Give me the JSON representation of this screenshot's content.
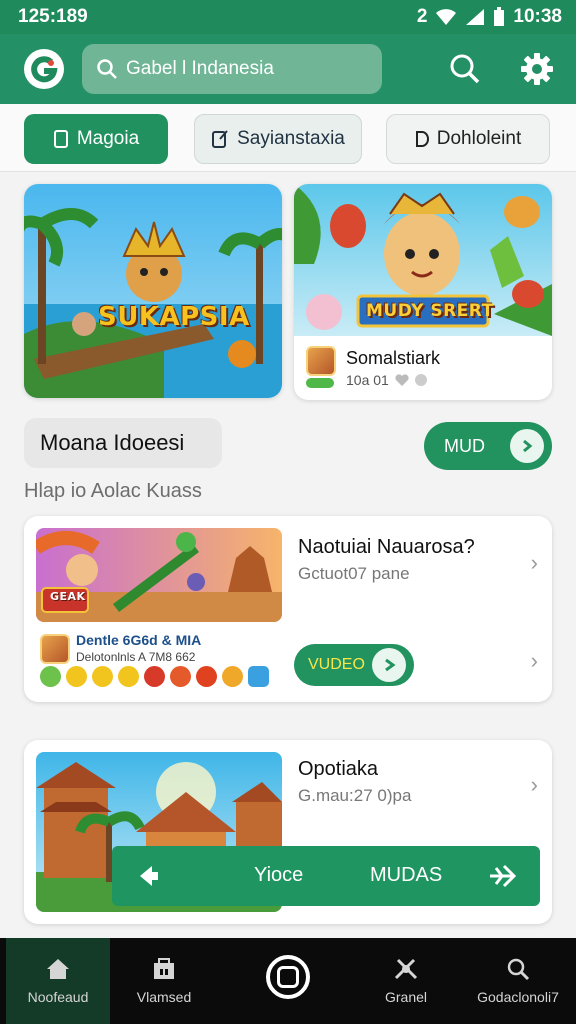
{
  "status_bar": {
    "time": "125:189",
    "right_time": "10:38",
    "signal_digit": "2"
  },
  "app_bar": {
    "search_text": "Gabel l Indanesia",
    "logo_letter": "G"
  },
  "tabs": [
    {
      "label": "Magoia",
      "active": true
    },
    {
      "label": "Sayianstaxia",
      "active": false
    },
    {
      "label": "Dohloleint",
      "active": false
    }
  ],
  "featured": [
    {
      "art_title": "SUKAPSIA"
    },
    {
      "art_title": "MUDY SRERT",
      "name": "Somalstiark",
      "meta": "10a 01"
    }
  ],
  "section": {
    "title": "Moana Idoeesi",
    "button_label": "MUD",
    "subtitle": "Hlap io Aolac Kuass"
  },
  "list": [
    {
      "title": "Naotuiai Nauarosa?",
      "meta": "Gctuot07 pane",
      "developer": "Dentle 6G6d & MIA",
      "dev_meta": "Delotonlnls A 7M8 662",
      "art_badge": "GEAK",
      "button_label": "VUDEO"
    },
    {
      "title": "Opotiaka",
      "meta": "G.mau:27 0)pa"
    }
  ],
  "action_bar": {
    "left_label": "Yioce",
    "right_label": "MUDAS"
  },
  "bottom_nav": [
    {
      "label": "Noofeaud",
      "icon": "home-icon"
    },
    {
      "label": "Vlamsed",
      "icon": "store-icon"
    },
    {
      "label": "Granel",
      "icon": "tools-icon"
    },
    {
      "label": "Godaclonoli7",
      "icon": "search-icon"
    }
  ],
  "colors": {
    "primary": "#239066",
    "primary_dark": "#1f8a5c",
    "nav_bg": "#0b0b0b"
  }
}
